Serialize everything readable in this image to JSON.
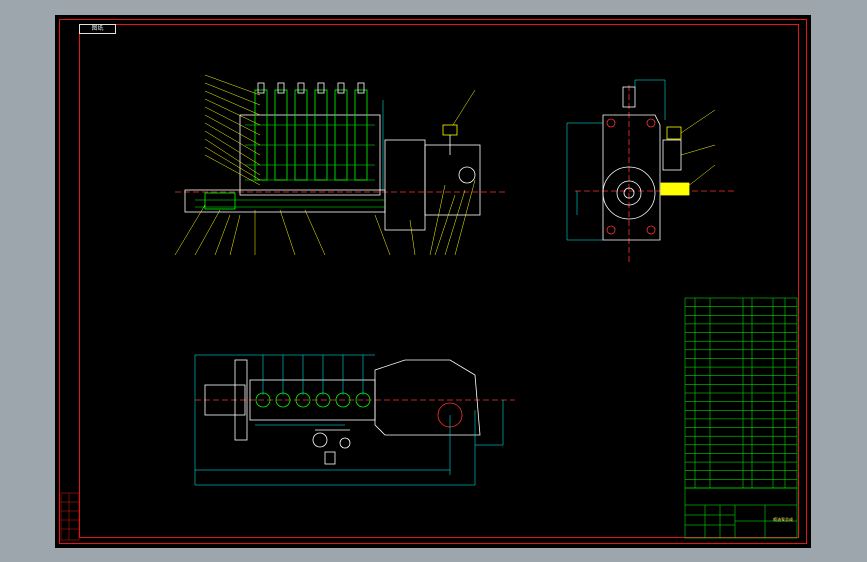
{
  "app": {
    "title": "",
    "drawing_tag": "图纸"
  },
  "colors": {
    "background_outer": "#9ea6ad",
    "model_space": "#000000",
    "border": "#e31515",
    "outline": "#ffffff",
    "hatch": "#00ff00",
    "leader": "#ffff00",
    "dimension": "#00ffff",
    "center_line": "#ff3030"
  },
  "parts_list": {
    "title_cell": "",
    "rows": 22
  },
  "title_block": {
    "name": "喷油泵总成",
    "drawing_no": ""
  }
}
